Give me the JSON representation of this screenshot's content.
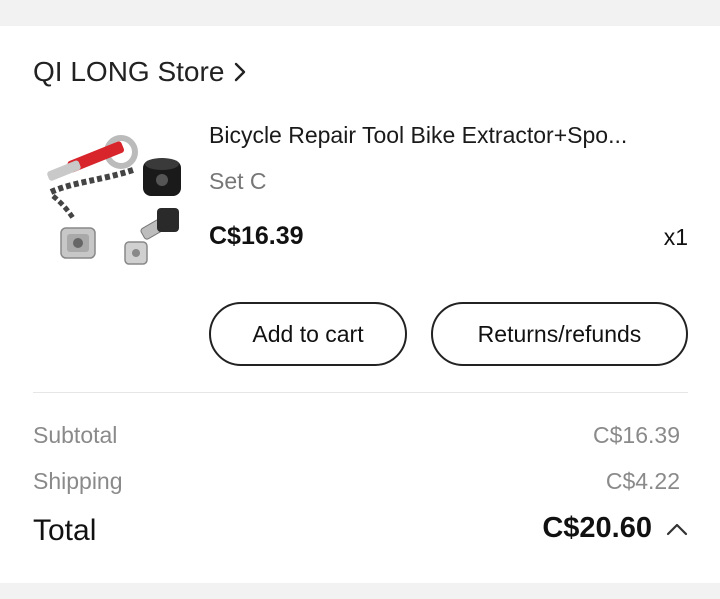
{
  "store": {
    "name": "QI LONG Store",
    "chevron_icon": "chevron-right-icon"
  },
  "product": {
    "title": "Bicycle Repair Tool Bike Extractor+Spo...",
    "variant": "Set C",
    "price": "C$16.39",
    "quantity": "x1",
    "image_icon": "bike-repair-tools-image"
  },
  "actions": {
    "add_to_cart": "Add to cart",
    "returns": "Returns/refunds"
  },
  "summary": {
    "subtotal_label": "Subtotal",
    "subtotal_value": "C$16.39",
    "shipping_label": "Shipping",
    "shipping_value": "C$4.22",
    "total_label": "Total",
    "total_value": "C$20.60",
    "toggle_icon": "chevron-up-icon"
  },
  "colors": {
    "background": "#f2f2f2",
    "card": "#ffffff",
    "text": "#111111",
    "muted": "#8a8a8a",
    "tool_red": "#d8242b"
  }
}
